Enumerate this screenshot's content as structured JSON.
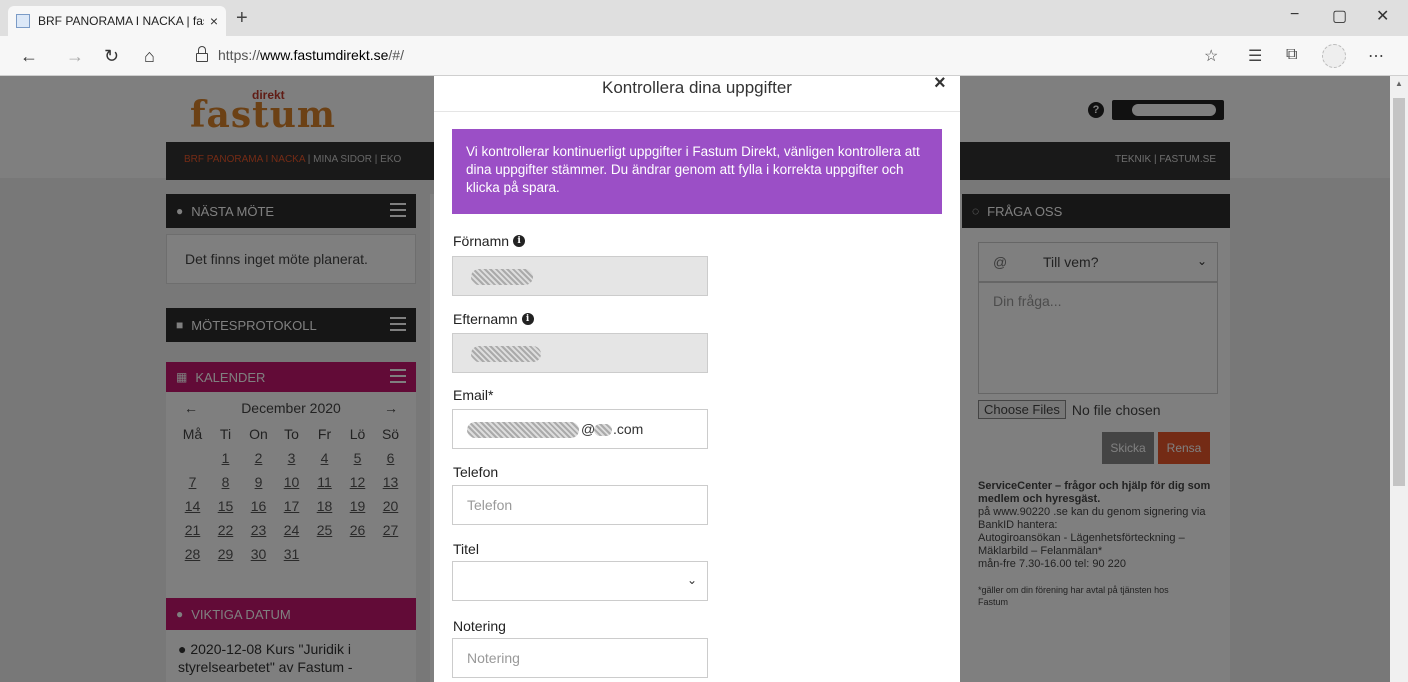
{
  "browser": {
    "tab_title": "BRF PANORAMA I NACKA | fastu",
    "tab_close": "×",
    "new_tab": "+",
    "window_controls": {
      "minimize": "−",
      "maximize": "▢",
      "close": "✕"
    },
    "nav": {
      "back": "←",
      "forward": "→",
      "refresh": "↻",
      "home": "⌂"
    },
    "url_scheme": "https://",
    "url_host": "www.fastumdirekt.se",
    "url_path": "/#/",
    "tools": {
      "favorite": "☆",
      "favorites_bar": "☰",
      "collections": "⧉",
      "more": "⋯"
    }
  },
  "site": {
    "logo_text": "fastum",
    "logo_small": "direkt",
    "help_icon": "?",
    "nav_active": "BRF PANORAMA I NACKA",
    "nav_left": " |  MINA SIDOR  |  EKO",
    "nav_right": "TEKNIK  |  FASTUM.SE"
  },
  "left": {
    "next_meeting": {
      "title": "NÄSTA MÖTE",
      "text": "Det finns inget möte planerat."
    },
    "protocols": {
      "title": "MÖTESPROTOKOLL"
    },
    "calendar": {
      "title": "KALENDER",
      "month": "December 2020",
      "prev": "←",
      "next": "→",
      "weekdays": [
        "Må",
        "Ti",
        "On",
        "To",
        "Fr",
        "Lö",
        "Sö"
      ],
      "days": [
        "",
        "1",
        "2",
        "3",
        "4",
        "5",
        "6",
        "7",
        "8",
        "9",
        "10",
        "11",
        "12",
        "13",
        "14",
        "15",
        "16",
        "17",
        "18",
        "19",
        "20",
        "21",
        "22",
        "23",
        "24",
        "25",
        "26",
        "27",
        "28",
        "29",
        "30",
        "31"
      ]
    },
    "important": {
      "title": "VIKTIGA DATUM",
      "line1": "2020-12-08 Kurs \"Juridik i",
      "line2": "styrelsearbetet\" av Fastum -"
    }
  },
  "right": {
    "ask": {
      "title": "FRÅGA OSS"
    },
    "to_select": "Till vem?",
    "at": "@",
    "question_placeholder": "Din fråga...",
    "choose_files": "Choose Files",
    "no_file": "No file chosen",
    "send": "Skicka",
    "clear": "Rensa",
    "sc_line1": "ServiceCenter – frågor och hjälp för dig som",
    "sc_line2": "medlem och hyresgäst.",
    "sc_line3": "på www.90220 .se kan du genom signering via",
    "sc_line4": "BankID hantera:",
    "sc_line5": "Autogiroansökan - Lägenhetsförteckning –",
    "sc_line6": "Mäklarbild – Felanmälan*",
    "sc_line7": "mån-fre 7.30-16.00 tel: 90 220",
    "note1": "*gäller om din förening har avtal på tjänsten hos",
    "note2": "Fastum"
  },
  "modal": {
    "title": "Kontrollera dina uppgifter",
    "close": "×",
    "alert": "Vi kontrollerar kontinuerligt uppgifter i Fastum Direkt, vänligen kontrollera att dina uppgifter stämmer. Du ändrar genom att fylla i korrekta uppgifter och klicka på spara.",
    "first_name_label": "Förnamn",
    "last_name_label": "Efternamn",
    "email_label": "Email*",
    "email_at": "@",
    "email_domain": ".com",
    "phone_label": "Telefon",
    "phone_placeholder": "Telefon",
    "title_label": "Titel",
    "title_value": "",
    "note_label": "Notering",
    "note_placeholder": "Notering",
    "info_glyph": "i"
  },
  "colors": {
    "accent_orange": "#e8562a",
    "calendar_magenta": "#c4176e",
    "alert_purple": "#9b4fc6",
    "nav_dark": "#333333"
  }
}
